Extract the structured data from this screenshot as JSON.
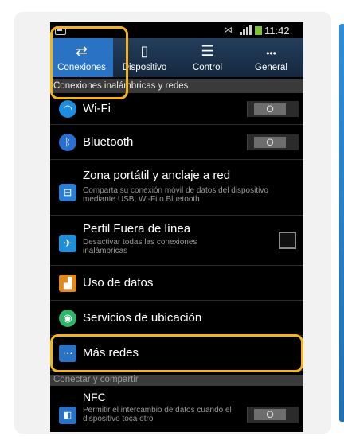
{
  "status_bar": {
    "mute_icon": "mute-icon",
    "time": "11:42"
  },
  "tabs": [
    {
      "label": "Conexiones",
      "icon": "swap-arrows-icon",
      "glyph": "⇄",
      "active": true
    },
    {
      "label": "Dispositivo",
      "icon": "phone-icon",
      "glyph": "▯",
      "active": false
    },
    {
      "label": "Control",
      "icon": "sliders-icon",
      "glyph": "☰",
      "active": false
    },
    {
      "label": "General",
      "icon": "more-dots-icon",
      "glyph": "•••",
      "active": false
    }
  ],
  "sections": {
    "wireless": "Conexiones inalámbricas y redes",
    "connect_share": "Conectar y compartir"
  },
  "items": {
    "wifi": {
      "title": "Wi-Fi",
      "toggle": "O",
      "icon": "wifi-icon",
      "color": "#1d8de0"
    },
    "bluetooth": {
      "title": "Bluetooth",
      "toggle": "O",
      "icon": "bluetooth-icon",
      "color": "#2a6fd0"
    },
    "hotspot": {
      "title": "Zona portátil y anclaje a red",
      "subtitle": "Comparta su conexión móvil de datos del dispositivo mediante USB, Wi-Fi o Bluetooth",
      "icon": "hotspot-icon",
      "color": "#2a7fd4"
    },
    "airplane": {
      "title": "Perfil Fuera de línea",
      "subtitle": "Desactivar todas las conexiones inalámbricas",
      "icon": "airplane-icon",
      "color": "#1f8fd8"
    },
    "data_usage": {
      "title": "Uso de datos",
      "icon": "data-usage-icon",
      "color": "#e08a1e"
    },
    "location": {
      "title": "Servicios de ubicación",
      "icon": "location-icon",
      "color": "#2fb46b"
    },
    "more_networks": {
      "title": "Más redes",
      "icon": "more-networks-icon",
      "color": "#2a73c4"
    },
    "nfc": {
      "title": "NFC",
      "subtitle": "Permitir el intercambio de datos cuando el dispositivo toca otro",
      "toggle": "O",
      "icon": "nfc-icon",
      "color": "#2a73c4"
    }
  },
  "highlight_color": "#f3b51b"
}
